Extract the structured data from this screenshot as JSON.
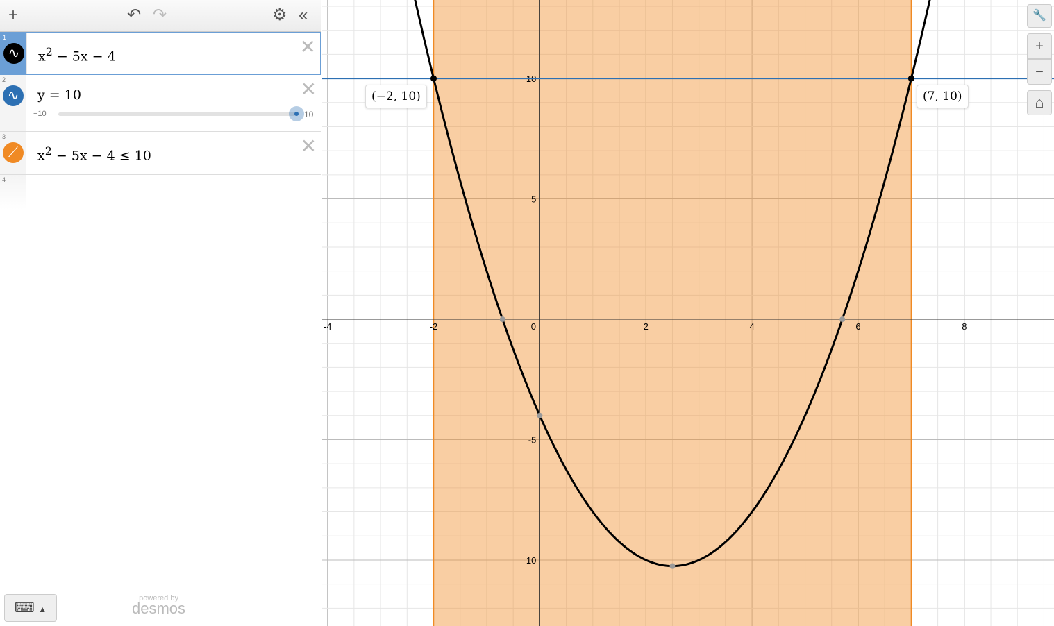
{
  "toolbar": {
    "add": "+",
    "undo": "↶",
    "redo": "↷",
    "settings": "⚙",
    "collapse": "«"
  },
  "expressions": [
    {
      "num": "1",
      "latex_html": "x<sup>2</sup> − 5x − 4",
      "color": "#000000",
      "icon": "wave-icon"
    },
    {
      "num": "2",
      "latex_html": "y = 10",
      "color": "#2d70b3",
      "icon": "wave-icon",
      "slider": {
        "min": "−10",
        "max": "10",
        "value": 10
      }
    },
    {
      "num": "3",
      "latex_html": "x<sup>2</sup> − 5x − 4 ≤ 10",
      "color": "#f08a24",
      "icon": "inequality-icon"
    },
    {
      "num": "4"
    }
  ],
  "footer": {
    "powered": "powered by",
    "brand": "desmos"
  },
  "controls": {
    "wrench": "🔧",
    "zoom_in": "+",
    "zoom_out": "−",
    "home": "⌂"
  },
  "graph": {
    "xrange": [
      -4.1,
      9.69
    ],
    "yrange": [
      -12.74,
      13.26
    ],
    "xticks": [
      "-4",
      "-2",
      "0",
      "2",
      "4",
      "6",
      "8"
    ],
    "yticks": [
      "10",
      "5",
      "-5",
      "-10"
    ],
    "parabola": {
      "a": 1,
      "b": -5,
      "c": -4,
      "color": "#000000"
    },
    "hline": {
      "y": 10,
      "color": "#2d70b3"
    },
    "shade": {
      "x1": -2,
      "x2": 7,
      "color": "#f08a24"
    },
    "points": [
      {
        "x": -2,
        "y": 10,
        "label": "(−2, 10)"
      },
      {
        "x": 7,
        "y": 10,
        "label": "(7, 10)"
      }
    ],
    "grey_points": [
      [
        -0.702,
        0
      ],
      [
        5.702,
        0
      ],
      [
        0,
        -4
      ],
      [
        2.5,
        -10.25
      ]
    ]
  }
}
